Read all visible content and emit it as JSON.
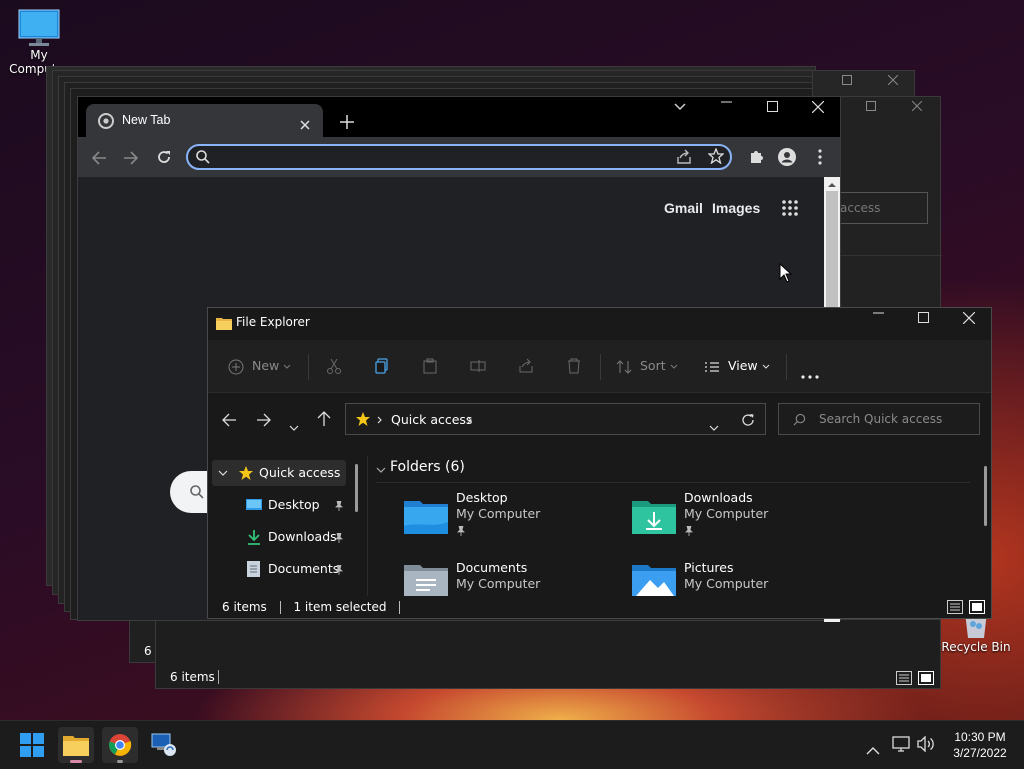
{
  "desktop": {
    "icons": [
      {
        "label": "My Computer",
        "icon": "monitor-icon"
      },
      {
        "label": "Recycle Bin",
        "icon": "recycle-bin-icon"
      }
    ]
  },
  "bg_windows": {
    "status_count": "6 items",
    "status_count_partial": "6 i",
    "search_partial": "access"
  },
  "chrome": {
    "tab_title": "New Tab",
    "omnibox_value": "",
    "links": {
      "gmail": "Gmail",
      "images": "Images"
    }
  },
  "explorer": {
    "title": "File Explorer",
    "toolbar": {
      "new": "New",
      "sort": "Sort",
      "view": "View"
    },
    "address": {
      "location": "Quick access"
    },
    "search_placeholder": "Search Quick access",
    "nav": {
      "quick_access": "Quick access",
      "items": [
        {
          "label": "Desktop"
        },
        {
          "label": "Downloads"
        },
        {
          "label": "Documents"
        }
      ]
    },
    "group_header": "Folders (6)",
    "folders": [
      {
        "name": "Desktop",
        "location": "My Computer"
      },
      {
        "name": "Downloads",
        "location": "My Computer"
      },
      {
        "name": "Documents",
        "location": "My Computer"
      },
      {
        "name": "Pictures",
        "location": "My Computer"
      }
    ],
    "status": {
      "count": "6 items",
      "selected": "1 item selected"
    }
  },
  "taskbar": {
    "time": "10:30 PM",
    "date": "3/27/2022"
  },
  "colors": {
    "accent": "#8ab4f8",
    "folder_blue": "#3aa0f0",
    "folder_teal": "#2bb59a"
  }
}
